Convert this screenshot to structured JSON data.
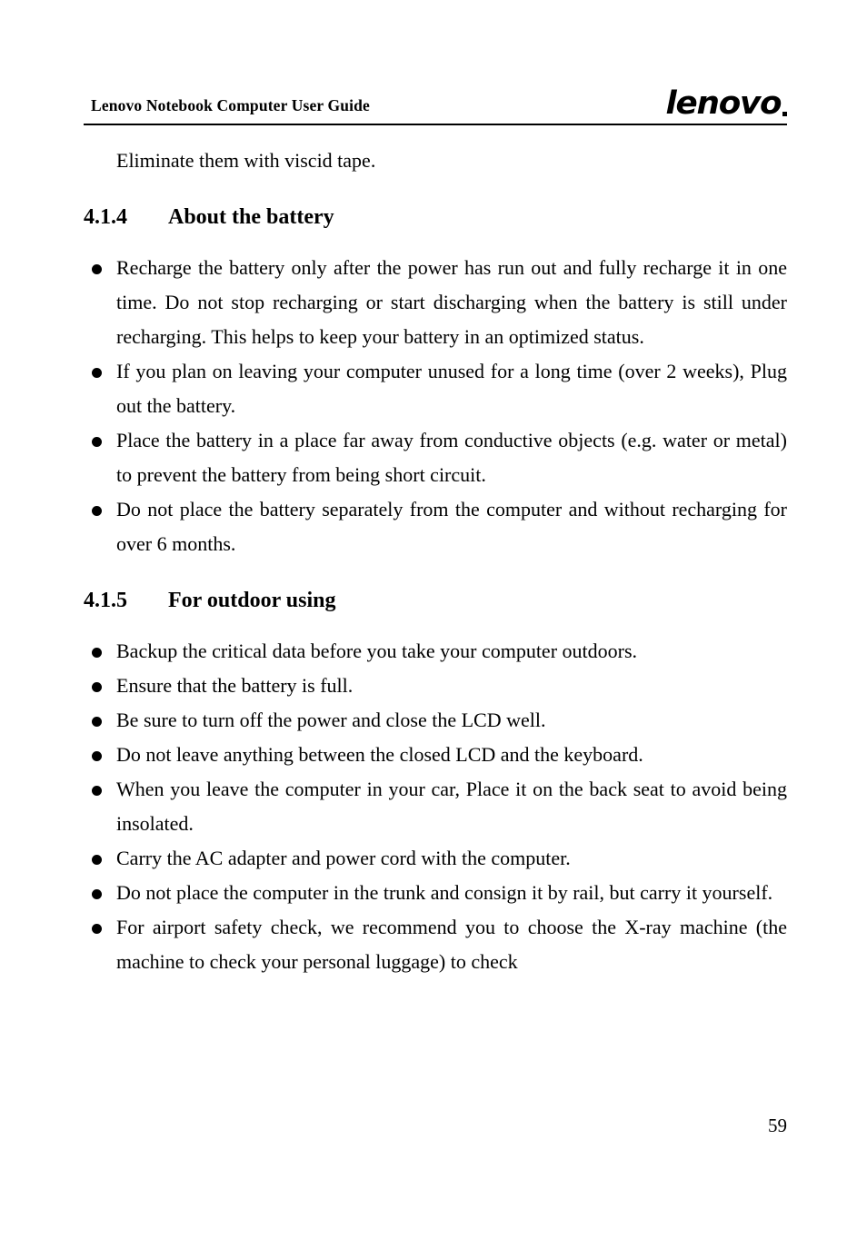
{
  "header": {
    "title": "Lenovo Notebook Computer User Guide",
    "logo_text": "lenovo",
    "logo_mark": "trademark-dot"
  },
  "body": {
    "lead_line": "Eliminate them with viscid tape."
  },
  "sections": [
    {
      "number": "4.1.4",
      "title": "About the battery",
      "bullets": [
        "Recharge the battery only after the power has run out and fully recharge it in one time. Do not stop recharging or start discharging when the battery is still under recharging. This helps to keep your battery in an optimized status.",
        "If you plan on leaving your computer unused for a long time (over 2 weeks), Plug out the battery.",
        "Place the battery in a place far away from conductive objects (e.g. water or metal) to prevent the battery from being short circuit.",
        "Do not place the battery separately from the computer and without recharging for over 6 months."
      ]
    },
    {
      "number": "4.1.5",
      "title": "For outdoor using",
      "bullets": [
        "Backup the critical data before you take your computer outdoors.",
        "Ensure that the battery is full.",
        "Be sure to turn off the power and close the LCD well.",
        "Do not leave anything between the closed LCD and the keyboard.",
        "When you leave the computer in your car, Place it on the back seat to avoid being insolated.",
        "Carry the AC adapter and power cord with the computer.",
        "Do not place the computer in the trunk and consign it by rail, but carry it yourself.",
        "For airport safety check, we recommend you to choose the X-ray machine (the machine to check your personal luggage) to check"
      ]
    }
  ],
  "footer": {
    "page_number": "59"
  }
}
